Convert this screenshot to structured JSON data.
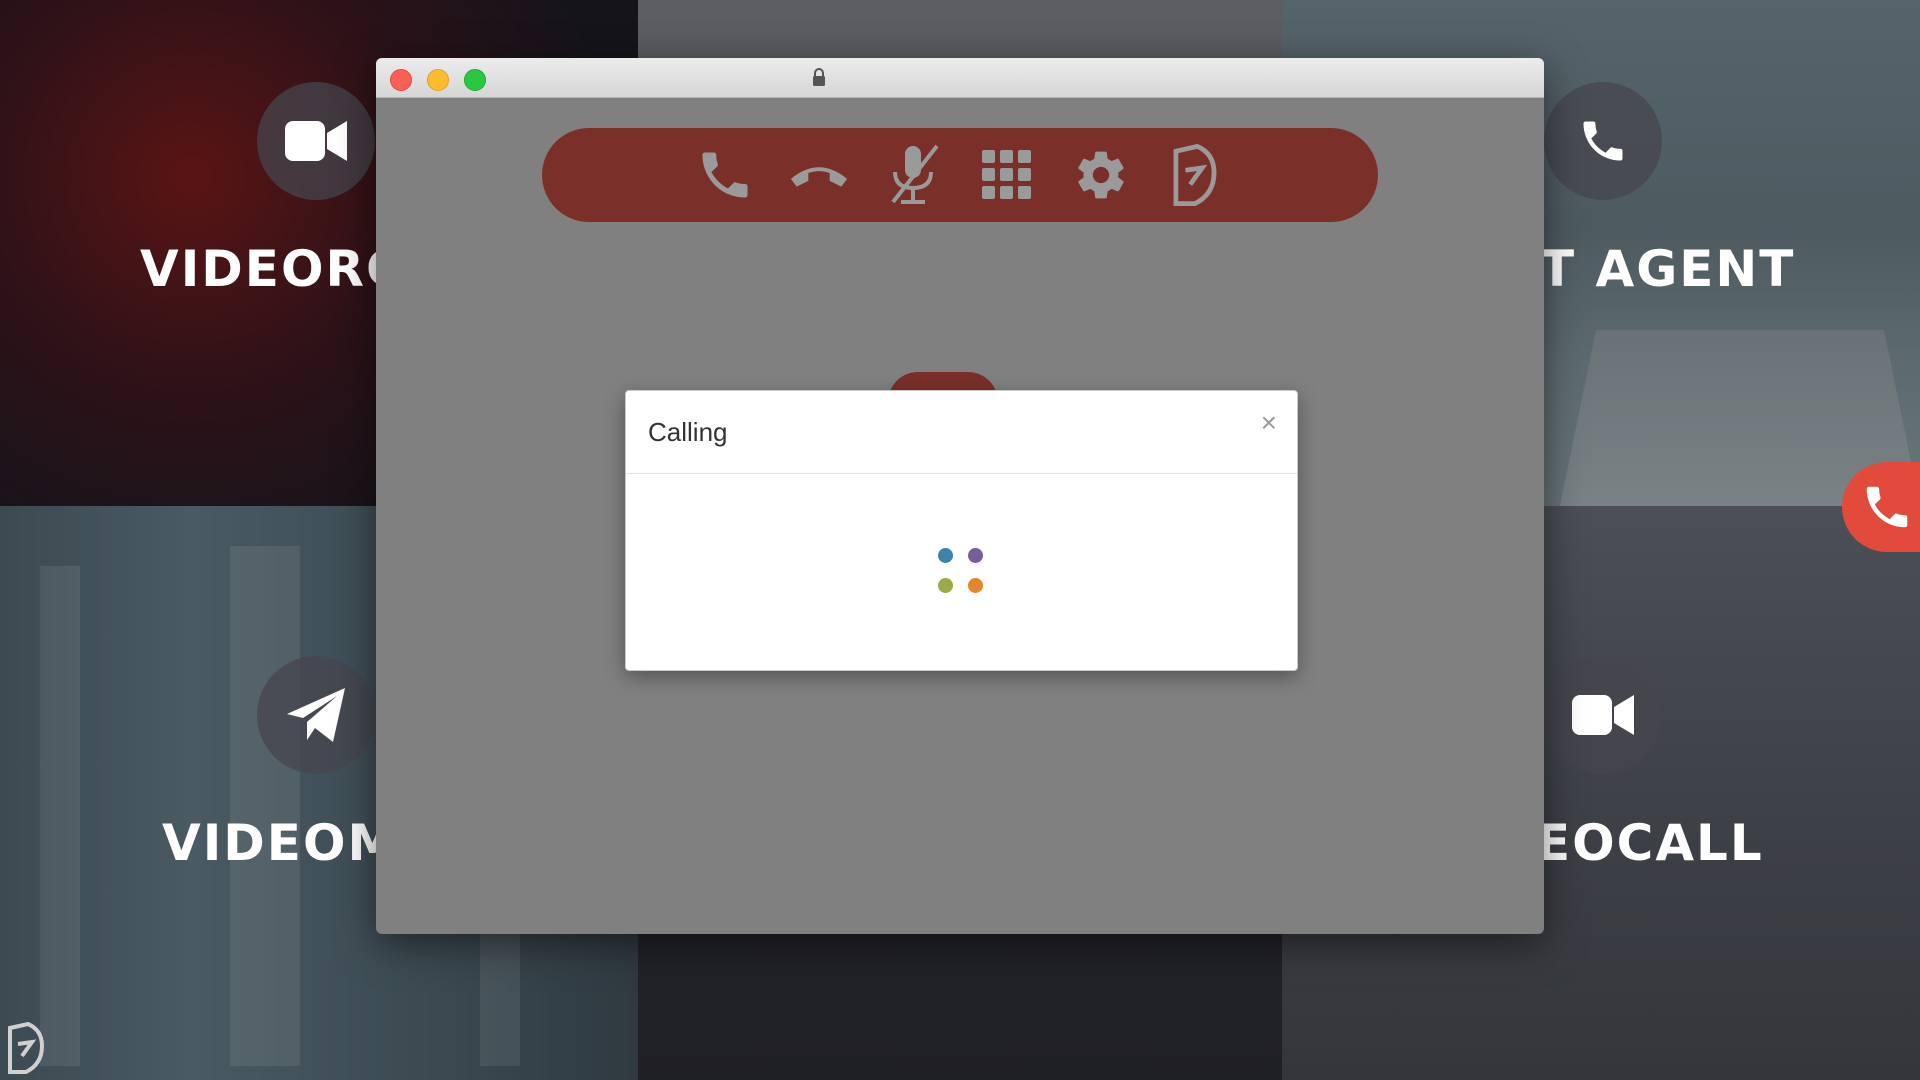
{
  "background": {
    "tiles": [
      {
        "label": "VIDEORC",
        "icon": "video-camera-icon"
      },
      {
        "label": "",
        "icon": ""
      },
      {
        "label": "T AGENT",
        "icon": "phone-icon"
      },
      {
        "label": "VIDEOM",
        "icon": "paper-plane-icon"
      },
      {
        "label": "",
        "icon": ""
      },
      {
        "label": "EOCALL",
        "icon": "video-camera-icon"
      }
    ],
    "floating_call_icon": "phone-icon"
  },
  "window": {
    "toolbar": [
      {
        "icon": "phone-icon"
      },
      {
        "icon": "hangup-icon"
      },
      {
        "icon": "mic-muted-icon"
      },
      {
        "icon": "dialpad-icon"
      },
      {
        "icon": "gear-icon"
      },
      {
        "icon": "brand-logo-icon"
      }
    ]
  },
  "modal": {
    "title": "Calling",
    "close_label": "×",
    "spinner_colors": [
      "#3e84a8",
      "#7a5c9c",
      "#9aab48",
      "#e2852b"
    ]
  },
  "colors": {
    "toolbar": "#7b2f29",
    "call_button": "#e24b3b",
    "overlay": "#808080"
  }
}
